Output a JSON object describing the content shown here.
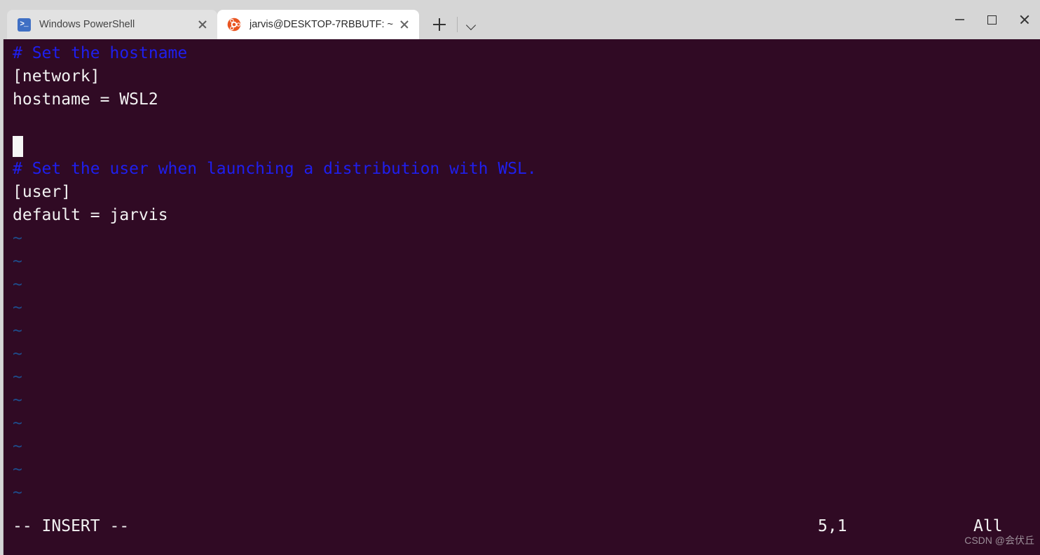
{
  "window": {
    "controls": {
      "minimize_label": "Minimize",
      "maximize_label": "Maximize",
      "close_label": "Close"
    }
  },
  "tabbar": {
    "tabs": [
      {
        "title": "Windows PowerShell",
        "icon": "powershell-icon",
        "icon_glyph": ">_",
        "active": false,
        "close_label": "Close tab"
      },
      {
        "title": "jarvis@DESKTOP-7RBBUTF: ~",
        "icon": "ubuntu-icon",
        "active": true,
        "close_label": "Close tab"
      }
    ],
    "new_tab_label": "New tab",
    "dropdown_label": "Open new tab dropdown"
  },
  "terminal": {
    "background_color": "#300a24",
    "comment_color": "#1f1fee",
    "text_color": "#f2f2f2",
    "tilde_color": "#1e4d8c",
    "lines": [
      {
        "text": "# Set the hostname",
        "type": "comment"
      },
      {
        "text": "[network]",
        "type": "text"
      },
      {
        "text": "hostname = WSL2",
        "type": "text"
      },
      {
        "text": "",
        "type": "text"
      },
      {
        "text": "",
        "type": "cursor"
      },
      {
        "text": "# Set the user when launching a distribution with WSL.",
        "type": "comment"
      },
      {
        "text": "[user]",
        "type": "text"
      },
      {
        "text": "default = jarvis",
        "type": "text"
      },
      {
        "text": "~",
        "type": "tilde"
      },
      {
        "text": "~",
        "type": "tilde"
      },
      {
        "text": "~",
        "type": "tilde"
      },
      {
        "text": "~",
        "type": "tilde"
      },
      {
        "text": "~",
        "type": "tilde"
      },
      {
        "text": "~",
        "type": "tilde"
      },
      {
        "text": "~",
        "type": "tilde"
      },
      {
        "text": "~",
        "type": "tilde"
      },
      {
        "text": "~",
        "type": "tilde"
      },
      {
        "text": "~",
        "type": "tilde"
      },
      {
        "text": "~",
        "type": "tilde"
      },
      {
        "text": "~",
        "type": "tilde"
      }
    ],
    "status": {
      "mode": "-- INSERT --",
      "position": "5,1",
      "scroll": "All"
    }
  },
  "watermark": {
    "text": "CSDN @会伏丘"
  }
}
